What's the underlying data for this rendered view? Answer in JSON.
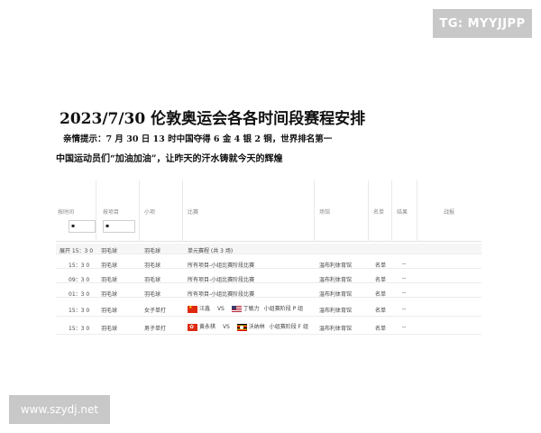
{
  "badges": {
    "tg": "TG: MYYJJPP",
    "site": "www.szydj.net"
  },
  "headline": "2023/7/30 伦敦奥运会各各时间段赛程安排",
  "tip": "亲情提示：7 月 30 日 13 时中国夺得 6 金 4 银 2 铜，世界排名第一",
  "slogan": "中国运动员们“加油加油”，让昨天的汗水铸就今天的辉煌",
  "table": {
    "headers": [
      "按时间",
      "按项目",
      "小项",
      "比赛",
      "场馆",
      "名单",
      "结果",
      "战报"
    ],
    "filters": [
      "▪",
      "▪"
    ],
    "rows": [
      {
        "time": "展开 15：3 0",
        "sport": "羽毛球",
        "event": "羽毛球",
        "match": "单元赛程 (共 3 场)",
        "venue": "",
        "list": "",
        "result": "",
        "session": true
      },
      {
        "time": "15：3 0",
        "sport": "羽毛球",
        "event": "羽毛球",
        "match": "所有项目-小组比赛阶段比赛",
        "venue": "温布利体育馆",
        "list": "名单",
        "result": "--"
      },
      {
        "time": "09：3 0",
        "sport": "羽毛球",
        "event": "羽毛球",
        "match": "所有项目-小组比赛阶段比赛",
        "venue": "温布利体育馆",
        "list": "名单",
        "result": "--"
      },
      {
        "time": "01：3 0",
        "sport": "羽毛球",
        "event": "羽毛球",
        "match": "所有项目-小组比赛阶段比赛",
        "venue": "温布利体育馆",
        "list": "名单",
        "result": "--"
      },
      {
        "time": "15：3 0",
        "sport": "羽毛球",
        "event": "女子单打",
        "p1": "汪鑫",
        "vs": "VS",
        "p2": "丁敏力",
        "stage": "小组赛阶段 P 组",
        "venue": "温布利体育馆",
        "list": "名单",
        "result": "--",
        "flag1": "cn",
        "flag2": "us"
      },
      {
        "time": "15：3 0",
        "sport": "羽毛球",
        "event": "男子单打",
        "p1": "黄永棋",
        "vs": "VS",
        "p2": "沃纳林",
        "stage": "小组赛阶段 F 组",
        "venue": "温布利体育馆",
        "list": "名单",
        "result": "--",
        "flag1": "hk",
        "flag2": "ug"
      }
    ]
  }
}
